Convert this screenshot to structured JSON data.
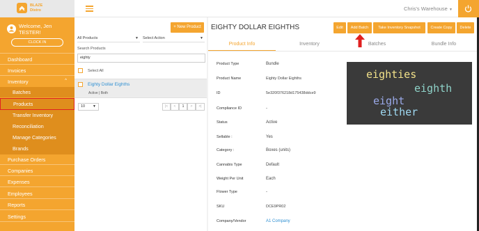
{
  "brand": {
    "line1": "BLAZE",
    "line2": "Distro"
  },
  "user": {
    "welcome": "Welcome, Jen",
    "name": "TESTER!",
    "clock_in": "CLOCK IN"
  },
  "nav": [
    {
      "label": "Dashboard"
    },
    {
      "label": "Invoices"
    },
    {
      "label": "Inventory",
      "chevron": "^"
    },
    {
      "label": "Batches"
    },
    {
      "label": "Products"
    },
    {
      "label": "Transfer Inventory"
    },
    {
      "label": "Reconciliation"
    },
    {
      "label": "Manage Categories"
    },
    {
      "label": "Brands"
    },
    {
      "label": "Purchase Orders"
    },
    {
      "label": "Companies"
    },
    {
      "label": "Expenses"
    },
    {
      "label": "Employees"
    },
    {
      "label": "Reports"
    },
    {
      "label": "Settings"
    }
  ],
  "header": {
    "warehouse": "Chris's Warehouse"
  },
  "products_panel": {
    "new_button": "+ New Product",
    "filter_select": "All Products",
    "action_select": "Select Action",
    "search_label": "Search Products",
    "search_value": "eighty",
    "select_all": "Select All",
    "item": {
      "name": "Eighty Dollar Eighths",
      "sub": "Active | Both"
    },
    "page_size": "10",
    "pager": {
      "first": "|<",
      "prev": "<",
      "page": "1",
      "next": ">",
      "last": ">|"
    }
  },
  "detail": {
    "title": "EIGHTY DOLLAR EIGHTHS",
    "actions": [
      "Edit",
      "Add Batch",
      "Take Inventory Snapshot",
      "Create Copy",
      "Delete"
    ],
    "tabs": [
      "Product Info",
      "Inventory",
      "Batches",
      "Bundle Info"
    ],
    "fields": [
      {
        "label": "Product Type",
        "value": "Bundle"
      },
      {
        "label": "Product Name",
        "value": "Eighty Dollar Eighths"
      },
      {
        "label": "ID",
        "value": "5e320f376218d175438ddce9"
      },
      {
        "label": "Compliance ID",
        "value": "-"
      },
      {
        "label": "Status",
        "value": "Active"
      },
      {
        "label": "Sellable :",
        "value": "Yes"
      },
      {
        "label": "Category :",
        "value": "Boxes (units)"
      },
      {
        "label": "Cannabis Type",
        "value": "Default"
      },
      {
        "label": "Weight Per Unit",
        "value": "Each"
      },
      {
        "label": "Flower Type",
        "value": "-"
      },
      {
        "label": "SKU",
        "value": "DCE9PR02"
      },
      {
        "label": "Company/Vendor",
        "value": "A1 Company"
      }
    ],
    "wordcloud": [
      {
        "word": "eighties",
        "color": "#f3e28a"
      },
      {
        "word": "eighth",
        "color": "#8fd3c9"
      },
      {
        "word": "eight",
        "color": "#9aa9e8"
      },
      {
        "word": "either",
        "color": "#9fd9f2"
      }
    ]
  },
  "colors": {
    "accent": "#f4a52f",
    "link": "#2e8fd2",
    "highlight": "#e02020"
  }
}
